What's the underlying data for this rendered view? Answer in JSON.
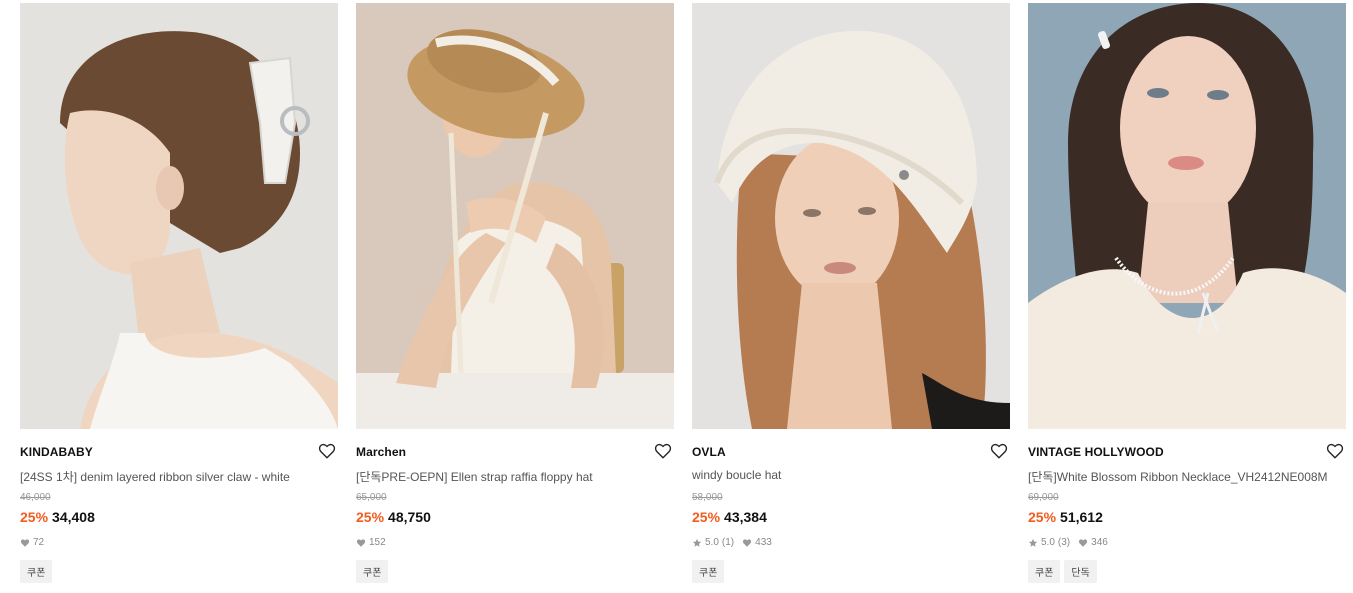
{
  "products": [
    {
      "brand": "KINDABABY",
      "name": "[24SS 1차] denim layered ribbon silver claw - white",
      "original_price": "46,000",
      "discount": "25%",
      "price": "34,408",
      "likes": "72",
      "tags": [
        "쿠폰"
      ],
      "image_icon": "hair-claw-photo"
    },
    {
      "brand": "Marchen",
      "name": "[단독PRE-OEPN] Ellen strap raffia floppy hat",
      "original_price": "65,000",
      "discount": "25%",
      "price": "48,750",
      "likes": "152",
      "tags": [
        "쿠폰"
      ],
      "image_icon": "raffia-hat-photo"
    },
    {
      "brand": "OVLA",
      "name": "windy boucle hat",
      "original_price": "58,000",
      "discount": "25%",
      "price": "43,384",
      "rating": "5.0",
      "reviews": "(1)",
      "likes": "433",
      "tags": [
        "쿠폰"
      ],
      "image_icon": "boucle-hat-photo"
    },
    {
      "brand": "VINTAGE HOLLYWOOD",
      "name": "[단독]White Blossom Ribbon Necklace_VH2412NE008M",
      "original_price": "69,000",
      "discount": "25%",
      "price": "51,612",
      "rating": "5.0",
      "reviews": "(3)",
      "likes": "346",
      "tags": [
        "쿠폰",
        "단독"
      ],
      "image_icon": "necklace-photo"
    }
  ],
  "colors": {
    "discount": "#f25c1e",
    "tag_bg": "#f1f1f1"
  }
}
